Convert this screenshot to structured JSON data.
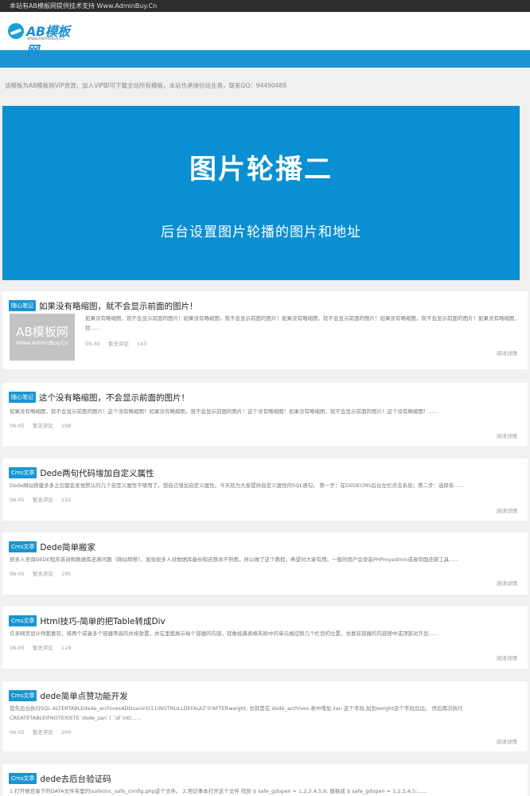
{
  "topbar": {
    "text": "本站有AB模板网提供技术支持 Www.AdminBuy.Cn"
  },
  "logo": {
    "text": "AB模板网",
    "sub": "Www.AdminBuy.Cn"
  },
  "notice": "该模板为AB模板网VIP资源，加入VIP即可下载全站所有模板，本站也承接仿站业务，联系QQ：94490489",
  "banner": {
    "title": "图片轮播二",
    "subtitle": "后台设置图片轮播的图片和地址"
  },
  "thumb": {
    "line1": "AB模板网",
    "line2": "Www.AdminBuy.Cn"
  },
  "colors": {
    "accent": "#1b95d1",
    "topbar": "#2d2d2d"
  },
  "articles": [
    {
      "tag": "随心笔记",
      "title": "如果没有略缩图，就不会显示前面的图片！",
      "excerpt": "如果没有略缩图，就不会显示前面的图片！如果没有略缩图，就不会显示前面的图片！如果没有略缩图，就不会显示前面的图片！如果没有略缩图，就不会显示前面的图片！如果没有略缩图，就......",
      "date": "05-30",
      "comments": "暂无评论",
      "views": "143",
      "read_more": "阅读详情"
    },
    {
      "tag": "随心笔记",
      "title": "这个没有略缩图，不会显示前面的图片！",
      "excerpt": "如果没有略缩图，就不会显示前面的图片！这个没有略缩图！如果没有略缩图，就不会显示前面的图片！这个没有略缩图！如果没有略缩图，就不会显示前面的图片！这个没有略缩图！......",
      "date": "06-05",
      "comments": "暂无评论",
      "views": "198",
      "read_more": "阅读详情"
    },
    {
      "tag": "Cms文章",
      "title": "Dede两句代码增加自定义属性",
      "excerpt": "Dede网站搭建多多之后都会发觉默认的几个自定义属性不够用了，想自己增加自定义属性。今天就为大家提供自定义属性的SQL语句。 第一步：在DEDECMS后台左栏点击系统；第二步：选择系......",
      "date": "06-05",
      "comments": "暂无评论",
      "views": "132",
      "read_more": "阅读详情"
    },
    {
      "tag": "Cms文章",
      "title": "Dede简单搬家",
      "excerpt": "很多人咨询DEDE程序该讲和数据库还原问题（网站转移），发现很多人对数据库备份和还原并不熟悉，所以做了这个教程，希望对大家有用。一般的用户会安装PHPmyadmin或者帝国还原工具......",
      "date": "06-05",
      "comments": "暂无评论",
      "views": "195",
      "read_more": "阅读详情"
    },
    {
      "tag": "Cms文章",
      "title": "Html技巧-简单的把Table转成Div",
      "excerpt": "许多网页设计师都喜欢，将两个或者多个容器等高的并排放置，并在里面展示每个容器的内容，就象经典表格布局中的单元格控制几个栏目的位置，也喜欢容器的内容居中或顶部对齐显......",
      "date": "06-05",
      "comments": "暂无评论",
      "views": "118",
      "read_more": "阅读详情"
    },
    {
      "tag": "Cms文章",
      "title": "dede简单点赞功能开发",
      "excerpt1": "首先后台执行SQL ALTERTABLEdede_archivesADDzanint(11)NOTNULLDEFAULT'0'AFTERweight; 也就是在 dede_archives 表中增加 zan 这个字段,加到weight这个字段后边。 然后再次执行",
      "excerpt2": "CREATETABLEIFNOTEXISTS`dede_zan`( `id`int(......",
      "date": "06-05",
      "comments": "暂无评论",
      "views": "200",
      "read_more": "阅读详情"
    },
    {
      "tag": "Cms文章",
      "title": "dede去后台验证码",
      "excerpt": "1.打开根目录下的DATA文件夹里的\\safe\\inc_safe_config.php这个文件。 2.用记事本打开这个文件 找到 $ safe_gdopen = 1,2,3,4,5,6; 替换成 $ safe_gdopen = 1,2,3,4,5;......"
    }
  ]
}
